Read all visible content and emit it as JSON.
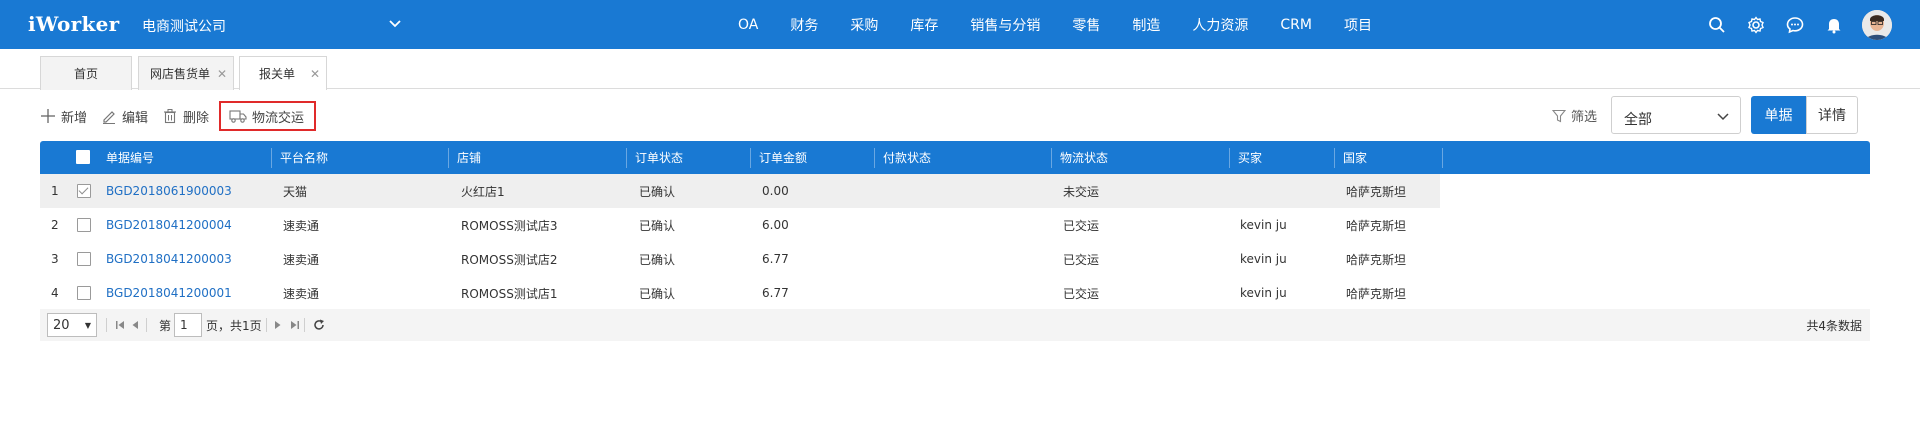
{
  "app": {
    "logo": "iWorker",
    "company": "电商测试公司",
    "nav": [
      "OA",
      "财务",
      "采购",
      "库存",
      "销售与分销",
      "零售",
      "制造",
      "人力资源",
      "CRM",
      "项目"
    ]
  },
  "colors": {
    "primary": "#1979d3",
    "highlight": "#e02a2a",
    "link": "#1f6fc4"
  },
  "tabs": [
    {
      "label": "首页",
      "closable": false
    },
    {
      "label": "网店售货单",
      "closable": true
    },
    {
      "label": "报关单",
      "closable": true,
      "active": true
    }
  ],
  "toolbar": {
    "add": "新增",
    "edit": "编辑",
    "delete": "删除",
    "logistics": "物流交运",
    "filter": "筛选",
    "select_value": "全部",
    "view_single": "单据",
    "view_detail": "详情"
  },
  "table": {
    "columns": [
      "单据编号",
      "平台名称",
      "店铺",
      "订单状态",
      "订单金额",
      "付款状态",
      "物流状态",
      "买家",
      "国家"
    ],
    "rows": [
      {
        "num": "1",
        "checked": true,
        "code": "BGD2018061900003",
        "platform": "天猫",
        "shop": "火红店1",
        "order_status": "已确认",
        "amount": "0.00",
        "pay_status": "",
        "logistics": "未交运",
        "buyer": "",
        "country": "哈萨克斯坦"
      },
      {
        "num": "2",
        "checked": false,
        "code": "BGD2018041200004",
        "platform": "速卖通",
        "shop": "ROMOSS测试店3",
        "order_status": "已确认",
        "amount": "6.00",
        "pay_status": "",
        "logistics": "已交运",
        "buyer": "kevin ju",
        "country": "哈萨克斯坦"
      },
      {
        "num": "3",
        "checked": false,
        "code": "BGD2018041200003",
        "platform": "速卖通",
        "shop": "ROMOSS测试店2",
        "order_status": "已确认",
        "amount": "6.77",
        "pay_status": "",
        "logistics": "已交运",
        "buyer": "kevin ju",
        "country": "哈萨克斯坦"
      },
      {
        "num": "4",
        "checked": false,
        "code": "BGD2018041200001",
        "platform": "速卖通",
        "shop": "ROMOSS测试店1",
        "order_status": "已确认",
        "amount": "6.77",
        "pay_status": "",
        "logistics": "已交运",
        "buyer": "kevin ju",
        "country": "哈萨克斯坦"
      }
    ]
  },
  "pager": {
    "page_size": "20",
    "page_prefix": "第",
    "page_value": "1",
    "page_suffix": "页，共1页",
    "total": "共4条数据"
  }
}
